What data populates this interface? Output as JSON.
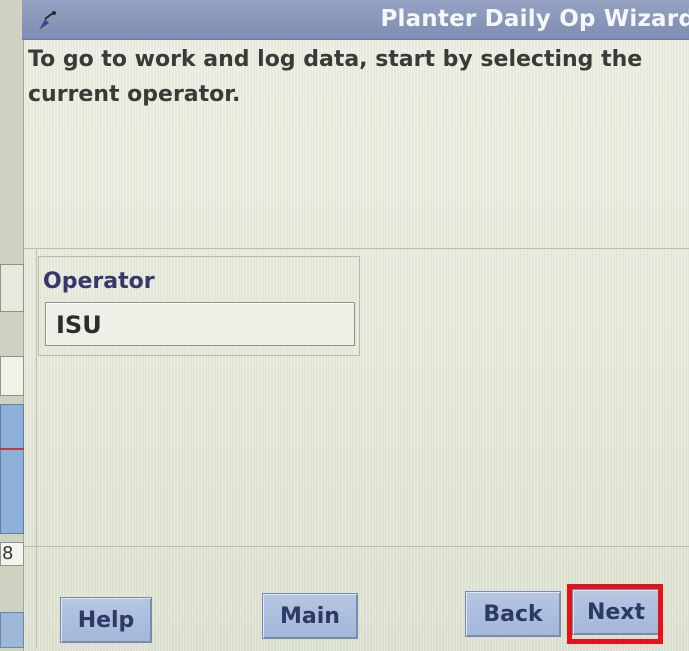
{
  "window": {
    "title": "Planter Daily Op Wizard",
    "app_icon": "planter-icon"
  },
  "instruction": {
    "text": "To go to work and log data, start by selecting the current operator."
  },
  "operator": {
    "label": "Operator",
    "value": "ISU"
  },
  "left_panel": {
    "number": "8"
  },
  "buttons": {
    "help": "Help",
    "main": "Main",
    "back": "Back",
    "next": "Next"
  },
  "colors": {
    "titlebar": "#8a97b9",
    "button": "#aebfe0",
    "highlight": "#e5121a",
    "background": "#e8eadc"
  }
}
